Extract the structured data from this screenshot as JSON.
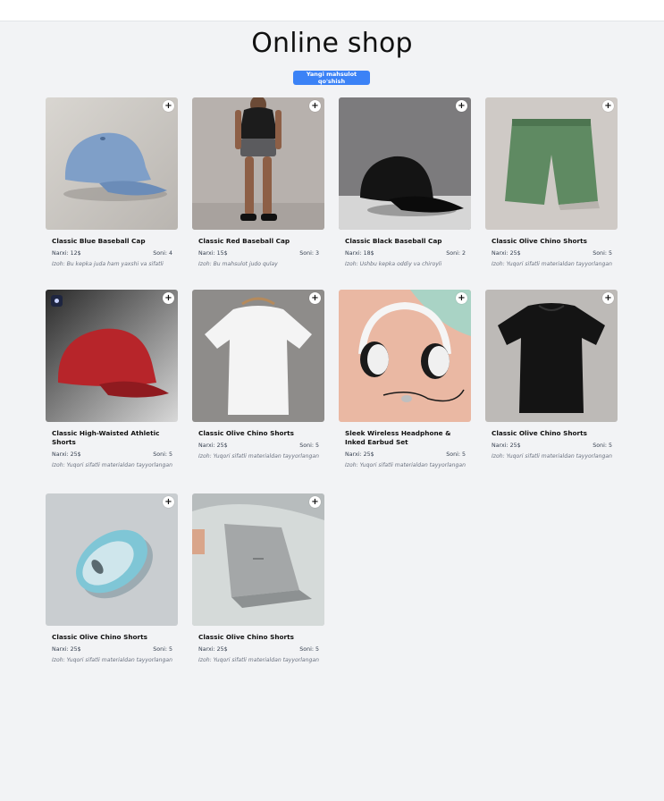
{
  "page": {
    "title": "Online shop"
  },
  "actions": {
    "add_product_label": "Yangi mahsulot qo'shish"
  },
  "products": [
    {
      "name": "Classic Blue Baseball Cap",
      "price": "Narxi: 12$",
      "qty": "Soni: 4",
      "desc": "Izoh: Bu kepka juda ham yaxshi va sifatli",
      "image": "blue-cap"
    },
    {
      "name": "Classic Red Baseball Cap",
      "price": "Narxi: 15$",
      "qty": "Soni: 3",
      "desc": "Izoh: Bu mahsulot judo qulay",
      "image": "athletic-shorts-model"
    },
    {
      "name": "Classic Black Baseball Cap",
      "price": "Narxi: 18$",
      "qty": "Soni: 2",
      "desc": "Izoh: Ushbu kepka oddiy va chiroyli",
      "image": "black-cap"
    },
    {
      "name": "Classic Olive Chino Shorts",
      "price": "Narxi: 25$",
      "qty": "Soni: 5",
      "desc": "Izoh: Yuqori sifatli materialdan tayyorlangan",
      "image": "olive-shorts"
    },
    {
      "name": "Classic High-Waisted Athletic Shorts",
      "price": "Narxi: 25$",
      "qty": "Soni: 5",
      "desc": "Izoh: Yuqori sifatli materialdan tayyorlangan",
      "image": "red-cap"
    },
    {
      "name": "Classic Olive Chino Shorts",
      "price": "Narxi: 25$",
      "qty": "Soni: 5",
      "desc": "Izoh: Yuqori sifatli materialdan tayyorlangan",
      "image": "white-tshirt"
    },
    {
      "name": "Sleek Wireless Headphone & Inked Earbud Set",
      "price": "Narxi: 25$",
      "qty": "Soni: 5",
      "desc": "Izoh: Yuqori sifatli materialdan tayyorlangan",
      "image": "headphones"
    },
    {
      "name": "Classic Olive Chino Shorts",
      "price": "Narxi: 25$",
      "qty": "Soni: 5",
      "desc": "Izoh: Yuqori sifatli materialdan tayyorlangan",
      "image": "black-tshirt"
    },
    {
      "name": "Classic Olive Chino Shorts",
      "price": "Narxi: 25$",
      "qty": "Soni: 5",
      "desc": "Izoh: Yuqori sifatli materialdan tayyorlangan",
      "image": "mouse"
    },
    {
      "name": "Classic Olive Chino Shorts",
      "price": "Narxi: 25$",
      "qty": "Soni: 5",
      "desc": "Izoh: Yuqori sifatli materialdan tayyorlangan",
      "image": "laptop"
    }
  ],
  "icons": {
    "add_to_cart": "plus-icon",
    "badge": "app-badge-icon"
  },
  "colors": {
    "accent": "#3b82f6",
    "background": "#f2f3f5"
  }
}
